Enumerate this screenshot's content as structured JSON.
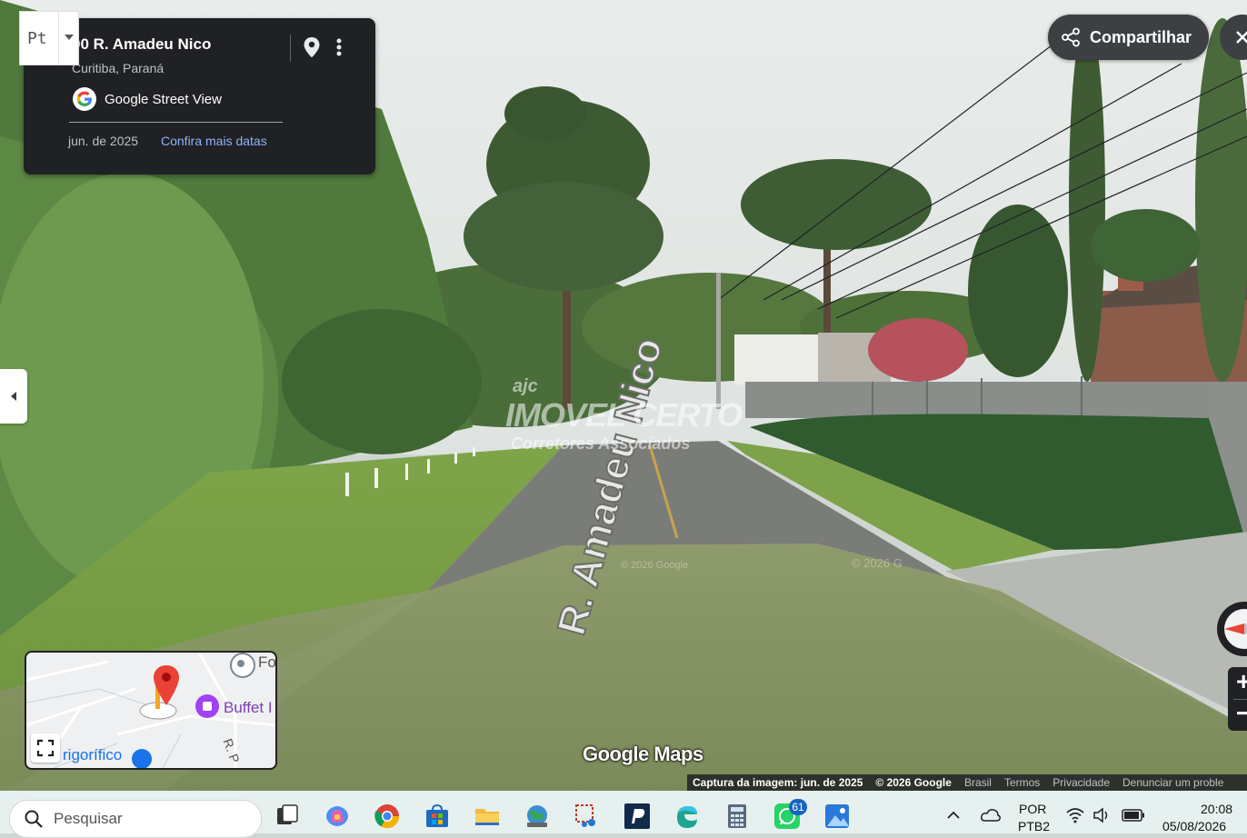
{
  "infoCard": {
    "address": "00 R. Amadeu Nico",
    "city": "Curitiba, Paraná",
    "service": "Google Street View",
    "date": "jun. de 2025",
    "moreDates": "Confira mais datas"
  },
  "badge": {
    "label": "Pt"
  },
  "share": {
    "label": "Compartilhar"
  },
  "scene": {
    "streetLabel": "R. Amadeu Nico",
    "watermarkTop": "IMOVEL CERTO",
    "watermarkSub": "Corretores Associados",
    "watermarkBrand": "ajc",
    "copyright1": "© 2026 Google",
    "copyright2": "© 2026 G"
  },
  "minimap": {
    "label1": "Fo",
    "label2": "Buffet I",
    "label3": "rigorífico",
    "label4": "R. P"
  },
  "googleMaps": "Google Maps",
  "attribution": {
    "capture": "Captura da imagem: jun. de 2025",
    "copyright": "© 2026 Google",
    "country": "Brasil",
    "terms": "Termos",
    "privacy": "Privacidade",
    "report": "Denunciar um proble"
  },
  "zoom": {
    "plus": "+",
    "minus": "−"
  },
  "taskbar": {
    "searchPlaceholder": "Pesquisar",
    "whatsappCount": "61",
    "lang1": "POR",
    "lang2": "PTB2",
    "time": "20:08",
    "date": "05/08/2026"
  },
  "colors": {
    "cardBg": "#202124",
    "link": "#8ab4f8",
    "taskbar": "#e6f0ef"
  }
}
